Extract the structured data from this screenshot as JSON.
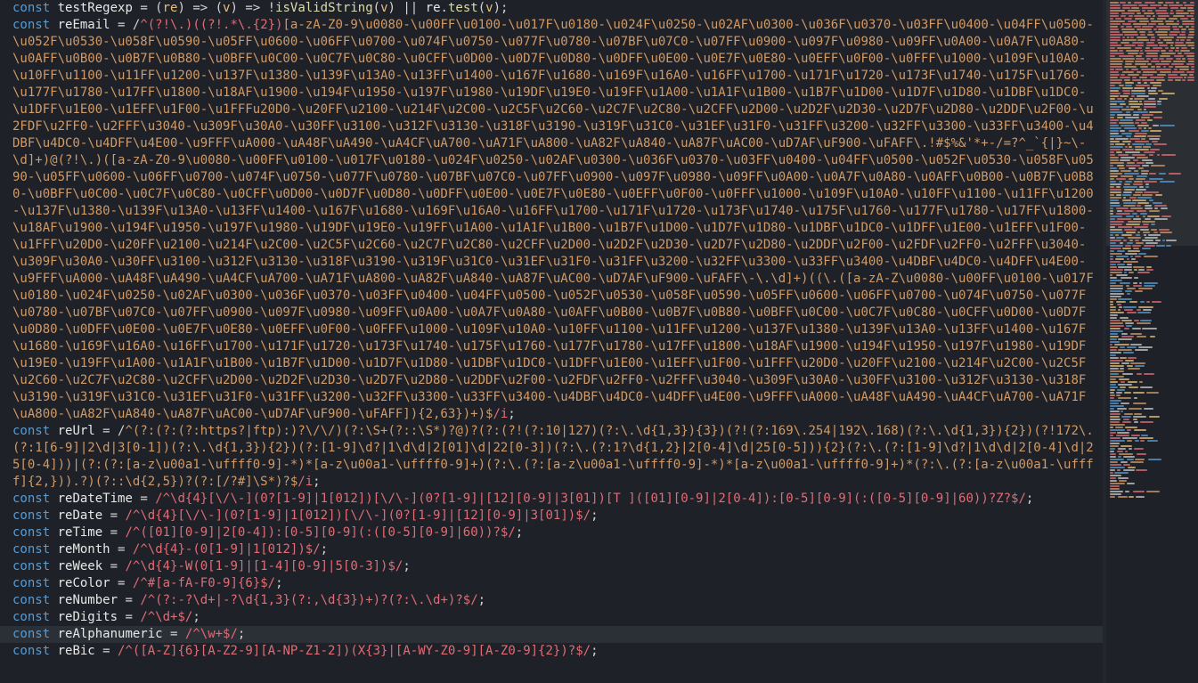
{
  "editor": {
    "lines": [
      {
        "id": "testRegexp",
        "tokens": [
          [
            "kw",
            "const"
          ],
          [
            "op",
            " "
          ],
          [
            "var",
            "testRegexp"
          ],
          [
            "op",
            " = ("
          ],
          [
            "param",
            "re"
          ],
          [
            "op",
            ") => ("
          ],
          [
            "param",
            "v"
          ],
          [
            "op",
            ") => !"
          ],
          [
            "ident",
            "isValidString"
          ],
          [
            "op",
            "("
          ],
          [
            "param",
            "v"
          ],
          [
            "op",
            ") || "
          ],
          [
            "var",
            "re"
          ],
          [
            "op",
            "."
          ],
          [
            "ident",
            "test"
          ],
          [
            "op",
            "("
          ],
          [
            "param",
            "v"
          ],
          [
            "op",
            ");"
          ]
        ]
      },
      {
        "id": "reEmail",
        "tokens": [
          [
            "kw",
            "const"
          ],
          [
            "op",
            " "
          ],
          [
            "var",
            "reEmail"
          ],
          [
            "op",
            " = /"
          ],
          [
            "re",
            "^(?!\\.)((?!.*\\.{2})"
          ],
          [
            "reo",
            "[a-zA-Z0-9\\u0080-\\u00FF\\u0100-\\u017F\\u0180-\\u024F\\u0250-\\u02AF\\u0300-\\u036F\\u0370-\\u03FF\\u0400-\\u04FF\\u0500-\\u052F\\u0530-\\u058F\\u0590-\\u05FF\\u0600-\\u06FF\\u0700-\\u074F\\u0750-\\u077F\\u0780-\\u07BF\\u07C0-\\u07FF\\u0900-\\u097F\\u0980-\\u09FF\\u0A00-\\u0A7F\\u0A80-\\u0AFF\\u0B00-\\u0B7F\\u0B80-\\u0BFF\\u0C00-\\u0C7F\\u0C80-\\u0CFF\\u0D00-\\u0D7F\\u0D80-\\u0DFF\\u0E00-\\u0E7F\\u0E80-\\u0EFF\\u0F00-\\u0FFF\\u1000-\\u109F\\u10A0-\\u10FF\\u1100-\\u11FF\\u1200-\\u137F\\u1380-\\u139F\\u13A0-\\u13FF\\u1400-\\u167F\\u1680-\\u169F\\u16A0-\\u16FF\\u1700-\\u171F\\u1720-\\u173F\\u1740-\\u175F\\u1760-\\u177F\\u1780-\\u17FF\\u1800-\\u18AF\\u1900-\\u194F\\u1950-\\u197F\\u1980-\\u19DF\\u19E0-\\u19FF\\u1A00-\\u1A1F\\u1B00-\\u1B7F\\u1D00-\\u1D7F\\u1D80-\\u1DBF\\u1DC0-\\u1DFF\\u1E00-\\u1EFF\\u1F00-\\u1FFFu20D0-\\u20FF\\u2100-\\u214F\\u2C00-\\u2C5F\\u2C60-\\u2C7F\\u2C80-\\u2CFF\\u2D00-\\u2D2F\\u2D30-\\u2D7F\\u2D80-\\u2DDF\\u2F00-\\u2FDF\\u2FF0-\\u2FFF\\u3040-\\u309F\\u30A0-\\u30FF\\u3100-\\u312F\\u3130-\\u318F\\u3190-\\u319F\\u31C0-\\u31EF\\u31F0-\\u31FF\\u3200-\\u32FF\\u3300-\\u33FF\\u3400-\\u4DBF\\u4DC0-\\u4DFF\\u4E00-\\u9FFF\\uA000-\\uA48F\\uA490-\\uA4CF\\uA700-\\uA71F\\uA800-\\uA82F\\uA840-\\uA87F\\uAC00-\\uD7AF\\uF900-\\uFAFF\\.!#$%&'*+-/=?^_`{|}~\\-\\d]+)@(?!\\.)"
          ],
          [
            "reo",
            "([a-zA-Z0-9\\u0080-\\u00FF\\u0100-\\u017F\\u0180-\\u024F\\u0250-\\u02AF\\u0300-\\u036F\\u0370-\\u03FF\\u0400-\\u04FF\\u0500-\\u052F\\u0530-\\u058F\\u0590-\\u05FF\\u0600-\\u06FF\\u0700-\\u074F\\u0750-\\u077F\\u0780-\\u07BF\\u07C0-\\u07FF\\u0900-\\u097F\\u0980-\\u09FF\\u0A00-\\u0A7F\\u0A80-\\u0AFF\\u0B00-\\u0B7F\\u0B80-\\u0BFF\\u0C00-\\u0C7F\\u0C80-\\u0CFF\\u0D00-\\u0D7F\\u0D80-\\u0DFF\\u0E00-\\u0E7F\\u0E80-\\u0EFF\\u0F00-\\u0FFF\\u1000-\\u109F\\u10A0-\\u10FF\\u1100-\\u11FF\\u1200-\\u137F\\u1380-\\u139F\\u13A0-\\u13FF\\u1400-\\u167F\\u1680-\\u169F\\u16A0-\\u16FF\\u1700-\\u171F\\u1720-\\u173F\\u1740-\\u175F\\u1760-\\u177F\\u1780-\\u17FF\\u1800-\\u18AF\\u1900-\\u194F\\u1950-\\u197F\\u1980-\\u19DF\\u19E0-\\u19FF\\u1A00-\\u1A1F\\u1B00-\\u1B7F\\u1D00-\\u1D7F\\u1D80-\\u1DBF\\u1DC0-\\u1DFF\\u1E00-\\u1EFF\\u1F00-\\u1FFF\\u20D0-\\u20FF\\u2100-\\u214F\\u2C00-\\u2C5F\\u2C60-\\u2C7F\\u2C80-\\u2CFF\\u2D00-\\u2D2F\\u2D30-\\u2D7F\\u2D80-\\u2DDF\\u2F00-\\u2FDF\\u2FF0-\\u2FFF\\u3040-\\u309F\\u30A0-\\u30FF\\u3100-\\u312F\\u3130-\\u318F\\u3190-\\u319F\\u31C0-\\u31EF\\u31F0-\\u31FF\\u3200-\\u32FF\\u3300-\\u33FF\\u3400-\\u4DBF\\u4DC0-\\u4DFF\\u4E00-\\u9FFF\\uA000-\\uA48F\\uA490-\\uA4CF\\uA700-\\uA71F\\uA800-\\uA82F\\uA840-\\uA87F\\uAC00-\\uD7AF\\uF900-\\uFAFF\\-\\.\\d]+)((\\."
          ],
          [
            "reo",
            "([a-zA-Z\\u0080-\\u00FF\\u0100-\\u017F\\u0180-\\u024F\\u0250-\\u02AF\\u0300-\\u036F\\u0370-\\u03FF\\u0400-\\u04FF\\u0500-\\u052F\\u0530-\\u058F\\u0590-\\u05FF\\u0600-\\u06FF\\u0700-\\u074F\\u0750-\\u077F\\u0780-\\u07BF\\u07C0-\\u07FF\\u0900-\\u097F\\u0980-\\u09FF\\u0A00-\\u0A7F\\u0A80-\\u0AFF\\u0B00-\\u0B7F\\u0B80-\\u0BFF\\u0C00-\\u0C7F\\u0C80-\\u0CFF\\u0D00-\\u0D7F\\u0D80-\\u0DFF\\u0E00-\\u0E7F\\u0E80-\\u0EFF\\u0F00-\\u0FFF\\u1000-\\u109F\\u10A0-\\u10FF\\u1100-\\u11FF\\u1200-\\u137F\\u1380-\\u139F\\u13A0-\\u13FF\\u1400-\\u167F\\u1680-\\u169F\\u16A0-\\u16FF\\u1700-\\u171F\\u1720-\\u173F\\u1740-\\u175F\\u1760-\\u177F\\u1780-\\u17FF\\u1800-\\u18AF\\u1900-\\u194F\\u1950-\\u197F\\u1980-\\u19DF\\u19E0-\\u19FF\\u1A00-\\u1A1F\\u1B00-\\u1B7F\\u1D00-\\u1D7F\\u1D80-\\u1DBF\\u1DC0-\\u1DFF\\u1E00-\\u1EFF\\u1F00-\\u1FFF\\u20D0-\\u20FF\\u2100-\\u214F\\u2C00-\\u2C5F\\u2C60-\\u2C7F\\u2C80-\\u2CFF\\u2D00-\\u2D2F\\u2D30-\\u2D7F\\u2D80-\\u2DDF\\u2F00-\\u2FDF\\u2FF0-\\u2FFF\\u3040-\\u309F\\u30A0-\\u30FF\\u3100-\\u312F\\u3130-\\u318F\\u3190-\\u319F\\u31C0-\\u31EF\\u31F0-\\u31FF\\u3200-\\u32FF\\u3300-\\u33FF\\u3400-\\u4DBF\\u4DC0-\\u4DFF\\u4E00-\\u9FFF\\uA000-\\uA48F\\uA490-\\uA4CF\\uA700-\\uA71F\\uA800-\\uA82F\\uA840-\\uA87F\\uAC00-\\uD7AF\\uF900-\\uFAFF]){2,63})+)$"
          ],
          [
            "re",
            "/i"
          ],
          [
            "op",
            ";"
          ]
        ]
      },
      {
        "id": "reUrl",
        "tokens": [
          [
            "kw",
            "const"
          ],
          [
            "op",
            " "
          ],
          [
            "var",
            "reUrl"
          ],
          [
            "op",
            " = /"
          ],
          [
            "reo",
            "^(?:(?:(?:https?|ftp):)?\\/\\/)(?:\\S+(?::\\S*)?@)?(?:(?!(?:10|127)(?:\\.\\d{1,3}){3})(?!(?:169\\.254|192\\.168)(?:\\.\\d{1,3}){2})(?!172\\.(?:1[6-9]|2\\d|3[0-1])(?:\\.\\d{1,3}){2})(?:[1-9]\\d?|1\\d\\d|2[01]\\d|22[0-3])(?:\\.(?:1?\\d{1,2}|2[0-4]\\d|25[0-5])){2}(?:\\.(?:[1-9]\\d?|1\\d\\d|2[0-4]\\d|25[0-4]))|(?:(?:[a-z\\u00a1-\\uffff0-9]-*)*[a-z\\u00a1-\\uffff0-9]+)(?:\\.(?:[a-z\\u00a1-\\uffff0-9]-*)*[a-z\\u00a1-\\uffff0-9]+)*(?:\\.(?:[a-z\\u00a1-\\uffff]{2,})).?)(?::\\d{2,5})?(?:[/?#]\\S*)?$"
          ],
          [
            "re",
            "/i"
          ],
          [
            "op",
            ";"
          ]
        ]
      },
      {
        "id": "reDateTime",
        "tokens": [
          [
            "kw",
            "const"
          ],
          [
            "op",
            " "
          ],
          [
            "var",
            "reDateTime"
          ],
          [
            "op",
            " = "
          ],
          [
            "re",
            "/^\\d{4}[\\/\\-](0?[1-9]|1[012])[\\/\\-](0?[1-9]|[12][0-9]|3[01])[T ]([01][0-9]|2[0-4]):[0-5][0-9](:([0-5][0-9]|60))?Z?$/"
          ],
          [
            "op",
            ";"
          ]
        ]
      },
      {
        "id": "reDate",
        "tokens": [
          [
            "kw",
            "const"
          ],
          [
            "op",
            " "
          ],
          [
            "var",
            "reDate"
          ],
          [
            "op",
            " = "
          ],
          [
            "re",
            "/^\\d{4}[\\/\\-](0?[1-9]|1[012])[\\/\\-](0?[1-9]|[12][0-9]|3[01])$/"
          ],
          [
            "op",
            ";"
          ]
        ]
      },
      {
        "id": "reTime",
        "tokens": [
          [
            "kw",
            "const"
          ],
          [
            "op",
            " "
          ],
          [
            "var",
            "reTime"
          ],
          [
            "op",
            " = "
          ],
          [
            "re",
            "/^([01][0-9]|2[0-4]):[0-5][0-9](:([0-5][0-9]|60))?$/"
          ],
          [
            "op",
            ";"
          ]
        ]
      },
      {
        "id": "reMonth",
        "tokens": [
          [
            "kw",
            "const"
          ],
          [
            "op",
            " "
          ],
          [
            "var",
            "reMonth"
          ],
          [
            "op",
            " = "
          ],
          [
            "re",
            "/^\\d{4}-(0[1-9]|1[012])$/"
          ],
          [
            "op",
            ";"
          ]
        ]
      },
      {
        "id": "reWeek",
        "tokens": [
          [
            "kw",
            "const"
          ],
          [
            "op",
            " "
          ],
          [
            "var",
            "reWeek"
          ],
          [
            "op",
            " = "
          ],
          [
            "re",
            "/^\\d{4}-W(0[1-9]|[1-4][0-9]|5[0-3])$/"
          ],
          [
            "op",
            ";"
          ]
        ]
      },
      {
        "id": "reColor",
        "tokens": [
          [
            "kw",
            "const"
          ],
          [
            "op",
            " "
          ],
          [
            "var",
            "reColor"
          ],
          [
            "op",
            " = "
          ],
          [
            "re",
            "/^#[a-fA-F0-9]{6}$/"
          ],
          [
            "op",
            ";"
          ]
        ]
      },
      {
        "id": "reNumber",
        "tokens": [
          [
            "kw",
            "const"
          ],
          [
            "op",
            " "
          ],
          [
            "var",
            "reNumber"
          ],
          [
            "op",
            " = "
          ],
          [
            "re",
            "/^(?:-?\\d+|-?\\d{1,3}(?:,\\d{3})+)?(?:\\.\\d+)?$/"
          ],
          [
            "op",
            ";"
          ]
        ]
      },
      {
        "id": "reDigits",
        "tokens": [
          [
            "kw",
            "const"
          ],
          [
            "op",
            " "
          ],
          [
            "var",
            "reDigits"
          ],
          [
            "op",
            " = "
          ],
          [
            "re",
            "/^\\d+$/"
          ],
          [
            "op",
            ";"
          ]
        ]
      },
      {
        "id": "reAlphanumeric",
        "current": true,
        "tokens": [
          [
            "kw",
            "const"
          ],
          [
            "op",
            " "
          ],
          [
            "var",
            "reAlphanumeric"
          ],
          [
            "op",
            " = "
          ],
          [
            "re",
            "/^\\w+$/"
          ],
          [
            "op",
            ";"
          ]
        ]
      },
      {
        "id": "reBic",
        "tokens": [
          [
            "kw",
            "const"
          ],
          [
            "op",
            " "
          ],
          [
            "var",
            "reBic"
          ],
          [
            "op",
            " = "
          ],
          [
            "re",
            "/^([A-Z]{6}[A-Z2-9][A-NP-Z1-2])(X{3}|[A-WY-Z0-9][A-Z0-9]{2})?$/"
          ],
          [
            "op",
            ";"
          ]
        ]
      }
    ]
  },
  "theme": {
    "background": "#1e2127",
    "keyword": "#569cd6",
    "string_regex": "#e06c75",
    "regex_class": "#d19a66",
    "param": "#e5c07b"
  }
}
